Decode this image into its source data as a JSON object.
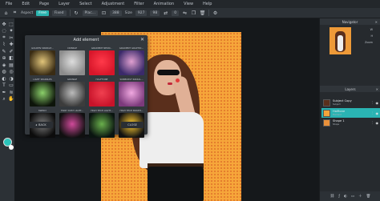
{
  "menu": [
    "File",
    "Edit",
    "Page",
    "Layer",
    "Select",
    "Adjustment",
    "Filter",
    "Animation",
    "View",
    "Help"
  ],
  "toolbar": {
    "mode_label": "Aspect",
    "mode_value": "Free",
    "method_label": "Fixed",
    "placement_label": "Plac...",
    "width_value": "388",
    "size_label": "Size",
    "height_value": "927",
    "pos_value": "98",
    "rot_value": "0"
  },
  "dialog": {
    "title": "Add element",
    "items": [
      {
        "label": "GOLDEN SPARKLE...",
        "c1": "#3a2c14",
        "c2": "#e1c57a"
      },
      {
        "label": "CRINKLE",
        "c1": "#8c8c8c",
        "c2": "#dddddd"
      },
      {
        "label": "GRADIENT NEON...",
        "c1": "#d8162a",
        "c2": "#ff3a4a"
      },
      {
        "label": "GRADIENT GRAPHIC...",
        "c1": "#3b2a6a",
        "c2": "#e0a0d0"
      },
      {
        "label": "LIGHT SPARKLES",
        "c1": "#0d140a",
        "c2": "#8bd06a"
      },
      {
        "label": "GRUNGE",
        "c1": "#3c3c3c",
        "c2": "#bbbbbb"
      },
      {
        "label": "HALFTONE",
        "c1": "#c8132a",
        "c2": "#f04050"
      },
      {
        "label": "SUNBURST RADIAL...",
        "c1": "#7c3a7c",
        "c2": "#f0a8e0"
      },
      {
        "label": "SWIRLY",
        "c1": "#0c0c0c",
        "c2": "#7a7a7a"
      },
      {
        "label": "FAIRY DUST LIGHT...",
        "c1": "#101010",
        "c2": "#d04a9a"
      },
      {
        "label": "HIGH TECH LIGHT...",
        "c1": "#0a1410",
        "c2": "#6ab04c"
      },
      {
        "label": "HIGH TECH BOKEH...",
        "c1": "#111111",
        "c2": "#ffcc33"
      }
    ],
    "back_label": "BACK",
    "close_label": "CLOSE"
  },
  "navigator": {
    "title": "Navigator",
    "w_label": "W",
    "h_label": "H",
    "zoom_label": "Zoom"
  },
  "layers": {
    "title": "Layers",
    "items": [
      {
        "name": "Subject Copy",
        "sub": "Subject",
        "thumb": "#5a2f1c",
        "active": false
      },
      {
        "name": "Halftone",
        "sub": "Element",
        "thumb": "#f3a43a",
        "active": true
      },
      {
        "name": "Shape 1",
        "sub": "Shape",
        "thumb": "#e8903a",
        "active": false
      }
    ]
  },
  "colors": {
    "accent": "#2bb5b0",
    "foreground": "#2bc3ba",
    "background": "#ffffff"
  }
}
